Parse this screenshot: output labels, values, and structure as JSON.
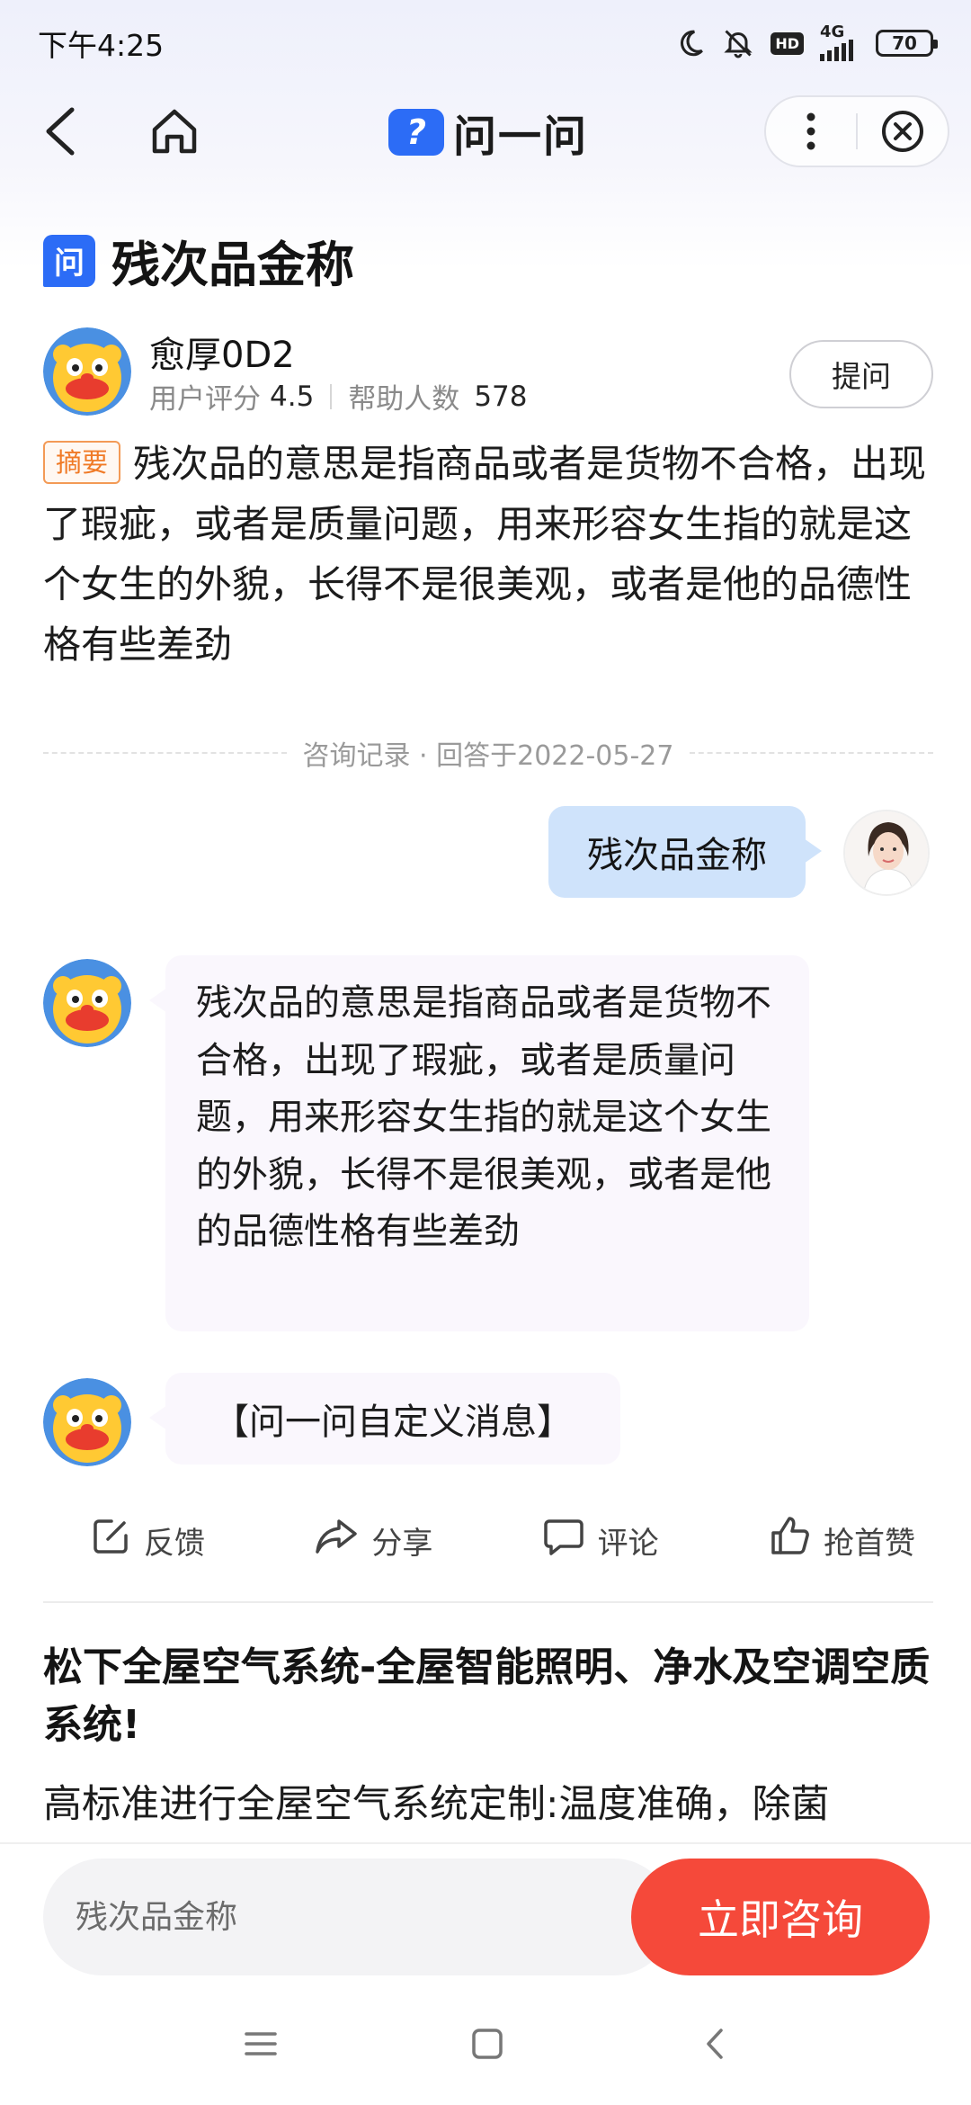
{
  "status_bar": {
    "time": "下午4:25",
    "network": "4G",
    "hd": "HD",
    "battery": "70"
  },
  "nav": {
    "brand_logo_char": "?",
    "brand_name": "问一问"
  },
  "question": {
    "badge": "问",
    "title": "残次品金称"
  },
  "answerer": {
    "name": "愈厚0D2",
    "rating_label": "用户评分",
    "rating_value": "4.5",
    "helped_label": "帮助人数",
    "helped_value": "578",
    "ask_button": "提问"
  },
  "summary": {
    "tag": "摘要",
    "text": "残次品的意思是指商品或者是货物不合格，出现了瑕疵，或者是质量问题，用来形容女生指的就是这个女生的外貌，长得不是很美观，或者是他的品德性格有些差劲"
  },
  "record": {
    "label": "咨询记录 · 回答于2022-05-27"
  },
  "chat": {
    "user_message": "残次品金称",
    "bot_message": "残次品的意思是指商品或者是货物不合格，出现了瑕疵，或者是质量问题，用来形容女生指的就是这个女生的外貌，长得不是很美观，或者是他的品德性格有些差劲",
    "bot_message_2": "【问一问自定义消息】"
  },
  "actions": {
    "feedback": "反馈",
    "share": "分享",
    "comment": "评论",
    "like": "抢首赞"
  },
  "ad": {
    "title": "松下全屋空气系统-全屋智能照明、净水及空调空质系统!",
    "desc": "高标准进行全屋空气系统定制:温度准确，除菌"
  },
  "bottom": {
    "input_placeholder": "残次品金称",
    "consult_button": "立即咨询"
  },
  "colors": {
    "brand_blue": "#2c6cf6",
    "consult_red": "#f5493a",
    "summary_orange": "#f07a26",
    "user_bubble": "#cfe3fb"
  }
}
